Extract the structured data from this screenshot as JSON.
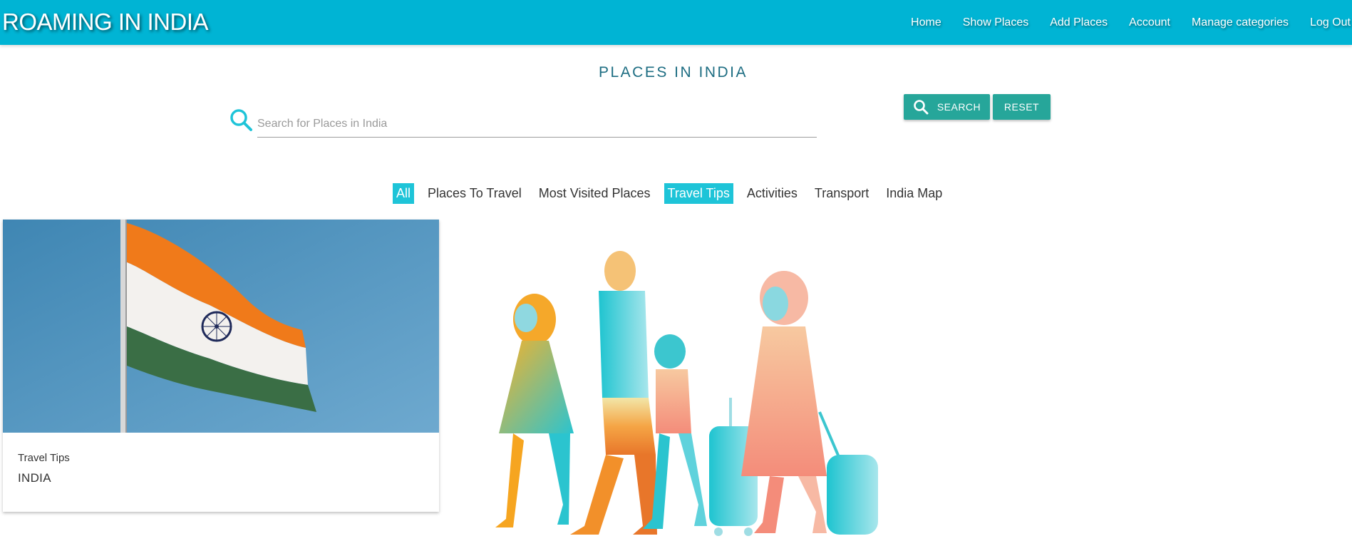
{
  "brand": "ROAMING IN INDIA",
  "nav": [
    {
      "label": "Home"
    },
    {
      "label": "Show Places"
    },
    {
      "label": "Add Places"
    },
    {
      "label": "Account"
    },
    {
      "label": "Manage categories"
    },
    {
      "label": "Log Out"
    }
  ],
  "page_title": "PLACES IN INDIA",
  "search": {
    "placeholder": "Search for Places in India",
    "value": "",
    "search_label": "SEARCH",
    "reset_label": "RESET",
    "icon": "search-icon"
  },
  "categories": [
    {
      "label": "All",
      "active": true
    },
    {
      "label": "Places To Travel",
      "active": false
    },
    {
      "label": "Most Visited Places",
      "active": false
    },
    {
      "label": "Travel Tips",
      "active": true
    },
    {
      "label": "Activities",
      "active": false
    },
    {
      "label": "Transport",
      "active": false
    },
    {
      "label": "India Map",
      "active": false
    }
  ],
  "cards": [
    {
      "category": "Travel Tips",
      "title": "INDIA",
      "image": "indian-flag-photo"
    }
  ],
  "illustration": "family-travel-illustration",
  "colors": {
    "navbar": "#00b4d4",
    "button": "#26a69a",
    "active_category": "#1ec4d8",
    "title": "#1d6d82"
  }
}
